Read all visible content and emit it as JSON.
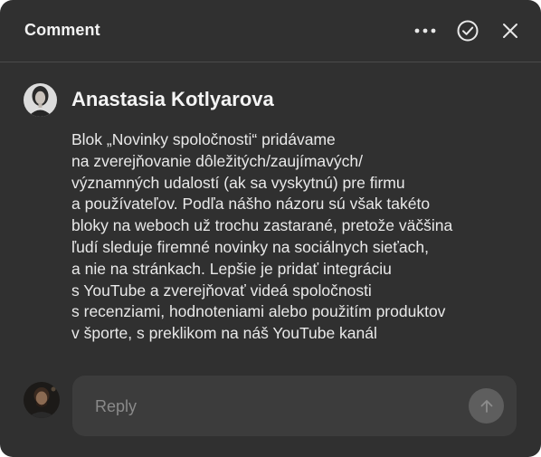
{
  "header": {
    "title": "Comment"
  },
  "icons": {
    "more": "more-horizontal-icon",
    "resolve": "check-circle-icon",
    "close": "close-icon",
    "send": "arrow-up-icon"
  },
  "comment": {
    "author": "Anastasia Kotlyarova",
    "lines": [
      "Blok „Novinky spoločnosti“ pridávame",
      "na zverejňovanie dôležitých/zaujímavých/",
      "významných udalostí (ak sa vyskytnú) pre firmu",
      "a používateľov. Podľa nášho názoru sú však takéto",
      "bloky na weboch už trochu zastarané, pretože väčšina",
      "ľudí sleduje firemné novinky na sociálnych sieťach,",
      "a nie na stránkach. Lepšie je pridať integráciu",
      "s YouTube a zverejňovať videá spoločnosti",
      "s recenziami, hodnoteniami alebo použitím produktov",
      "v športe, s preklikom na náš YouTube kanál"
    ]
  },
  "reply": {
    "placeholder": "Reply",
    "value": ""
  },
  "colors": {
    "panel": "#303030",
    "reply_box": "#3c3c3c",
    "send_button": "#5e5e5e",
    "text": "#e9e9e9"
  }
}
